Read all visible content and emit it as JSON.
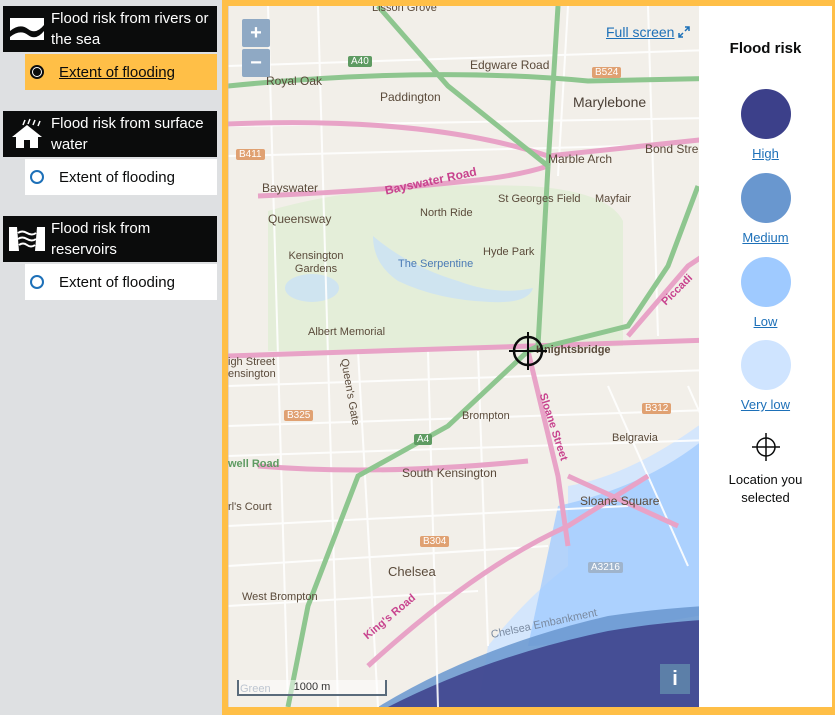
{
  "panel": {
    "groups": [
      {
        "title": "Flood risk from rivers or the sea",
        "option": "Extent of flooding",
        "selected": true,
        "icon": "river-icon"
      },
      {
        "title": "Flood risk from surface water",
        "option": "Extent of flooding",
        "selected": false,
        "icon": "house-rain-icon"
      },
      {
        "title": "Flood risk from reservoirs",
        "option": "Extent of flooding",
        "selected": false,
        "icon": "reservoir-icon"
      }
    ]
  },
  "map": {
    "zoom_in": "+",
    "zoom_out": "−",
    "full_screen": "Full screen",
    "info": "i",
    "scale": "1000 m",
    "labels": {
      "lisson_grove": "Lisson Grove",
      "royal_oak": "Royal Oak",
      "edgware_road": "Edgware Road",
      "paddington": "Paddington",
      "marylebone": "Marylebone",
      "marble_arch": "Marble Arch",
      "bond_street": "Bond Stre",
      "bayswater": "Bayswater",
      "bayswater_road": "Bayswater Road",
      "queensway": "Queensway",
      "north_ride": "North Ride",
      "st_georges_field": "St Georges Field",
      "mayfair": "Mayfair",
      "kensington_gardens": "Kensington Gardens",
      "the_serpentine": "The Serpentine",
      "hyde_park": "Hyde Park",
      "albert_memorial": "Albert Memorial",
      "knightsbridge": "Knightsbridge",
      "high_street_kensington": "igh Street\nensington",
      "queens_gate": "Queen's Gate",
      "brompton": "Brompton",
      "sloane_street": "Sloane Street",
      "belgravia": "Belgravia",
      "south_kensington": "South Kensington",
      "well_road": "well Road",
      "earls_court": "rl's Court",
      "sloane_square": "Sloane Square",
      "chelsea": "Chelsea",
      "west_brompton": "West Brompton",
      "kings_road": "King's Road",
      "chelsea_embankment": "Chelsea Embankment",
      "piccadilly": "Piccadi",
      "green": "Green"
    },
    "road_tags": {
      "a40": "A40",
      "b524": "B524",
      "b411": "B411",
      "b325": "B325",
      "a4": "A4",
      "b312": "B312",
      "b304": "B304",
      "a3216": "A3216"
    }
  },
  "legend": {
    "title": "Flood risk",
    "items": [
      {
        "label": "High",
        "color": "#3c408a"
      },
      {
        "label": "Medium",
        "color": "#6997cf"
      },
      {
        "label": "Low",
        "color": "#9fcaff"
      },
      {
        "label": "Very low",
        "color": "#cfe4ff"
      }
    ],
    "location_label": "Location you selected"
  }
}
